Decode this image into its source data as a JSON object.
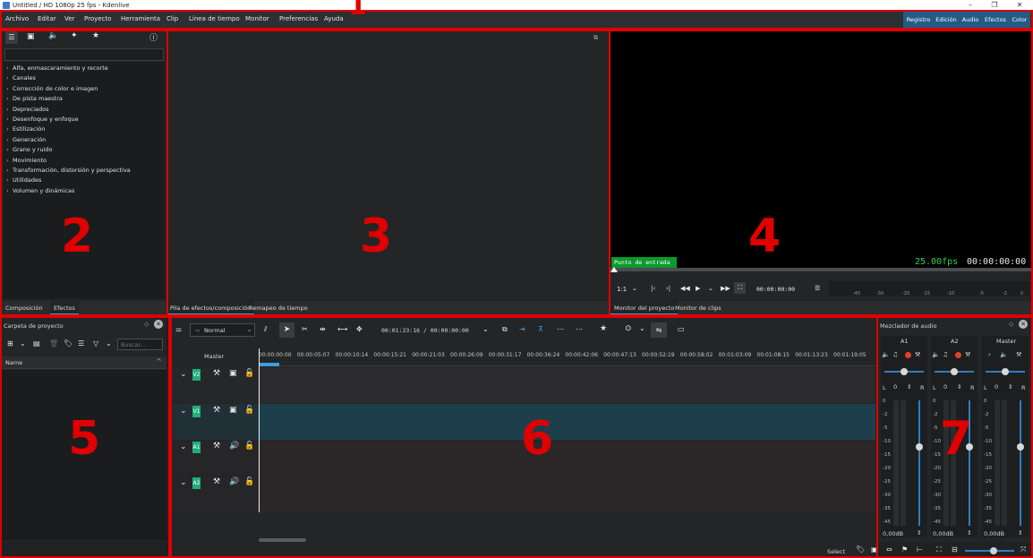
{
  "titlebar": {
    "title": "Untitled / HD 1080p 25 fps - Kdenlive",
    "minimize": "–",
    "maximize": "❐",
    "close": "✕"
  },
  "menu": [
    "Archivo",
    "Editar",
    "Ver",
    "Proyecto",
    "Herramienta",
    "Clip",
    "Línea de tiempo",
    "Monitor",
    "Preferencias",
    "Ayuda"
  ],
  "workspaces": [
    "Registro",
    "Edición",
    "Audio",
    "Efectos",
    "Color"
  ],
  "annotations": [
    "1",
    "2",
    "3",
    "4",
    "5",
    "6",
    "7"
  ],
  "effects": {
    "tabs": [
      "Composición",
      "Efectos"
    ],
    "items": [
      "Alfa, enmascaramiento y recorte",
      "Canales",
      "Corrección de color e imagen",
      "De pista maestra",
      "Depreciados",
      "Desenfoque y enfoque",
      "Estilización",
      "Generación",
      "Grano y ruido",
      "Movimiento",
      "Transformación, distorsión y perspectiva",
      "Utilidades",
      "Volumen y dinámicas"
    ]
  },
  "stack": {
    "tabs": [
      "Pila de efectos/composición",
      "Remapeo de tiempo"
    ]
  },
  "monitor": {
    "inpoint_label": "Punto de entrada",
    "fps": "25.00fps",
    "timecode": "00:00:00:00",
    "zoom": "1:1",
    "position": "00:00:00:00",
    "vu_scale": [
      "-45",
      "-30",
      "-20",
      "-15",
      "-10",
      "-5",
      "-2",
      "0"
    ],
    "tabs": [
      "Monitor del proyecto",
      "Monitor de clips"
    ]
  },
  "project_bin": {
    "title": "Carpeta de proyecto",
    "search_placeholder": "Buscar...",
    "column_name": "Name"
  },
  "timeline": {
    "mode": "Normal",
    "timecode": "00:01:23:16 / 00:00:00:00",
    "master_label": "Master",
    "ruler": [
      "00:00:00:00",
      "00:00:05:07",
      "00:00:10:14",
      "00:00:15:21",
      "00:00:21:03",
      "00:00:26:09",
      "00:00:31:17",
      "00:00:36:24",
      "00:00:42:06",
      "00:00:47:13",
      "00:00:52:19",
      "00:00:58:02",
      "00:01:03:09",
      "00:01:08:15",
      "00:01:13:23",
      "00:01:19:05"
    ],
    "tracks": [
      {
        "badge": "V2",
        "type": "video"
      },
      {
        "badge": "V1",
        "type": "video"
      },
      {
        "badge": "A1",
        "type": "audio"
      },
      {
        "badge": "A2",
        "type": "audio"
      }
    ],
    "status_select": "Select"
  },
  "mixer": {
    "title": "Mezclador de audio",
    "channels": [
      {
        "name": "A1",
        "gain": "0,00dB",
        "pan": "0"
      },
      {
        "name": "A2",
        "gain": "0,00dB",
        "pan": "0"
      },
      {
        "name": "Master",
        "gain": "0,00dB",
        "pan": "0"
      }
    ],
    "db_scale": [
      "0",
      "-2",
      "-5",
      "-10",
      "-15",
      "-20",
      "-25",
      "-30",
      "-35",
      "-45"
    ],
    "pan_left": "L",
    "pan_right": "R"
  }
}
